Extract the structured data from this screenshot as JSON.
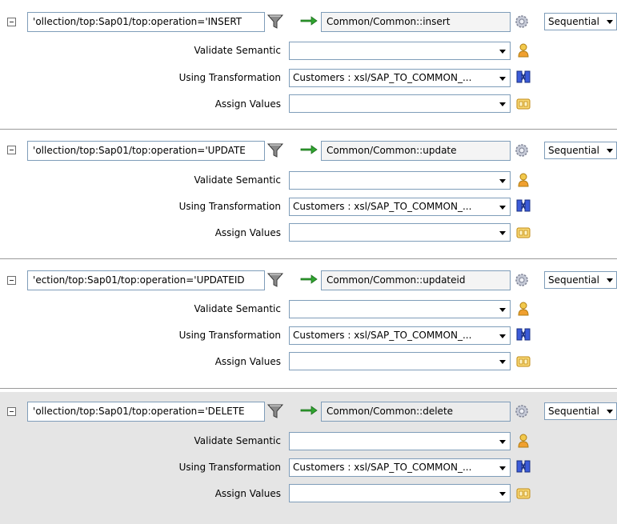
{
  "labels": {
    "validate_semantic": "Validate Semantic",
    "using_transformation": "Using Transformation",
    "assign_values": "Assign Values"
  },
  "routings": [
    {
      "filter_expression": "ollection/top:Sap01/top:operation='INSERT'",
      "target_operation": "Common/Common::insert",
      "execution": "Sequential",
      "validate_semantic": "",
      "transformation": "Customers : xsl/SAP_TO_COMMON_...",
      "assign_values": ""
    },
    {
      "filter_expression": "ollection/top:Sap01/top:operation='UPDATE'",
      "target_operation": "Common/Common::update",
      "execution": "Sequential",
      "validate_semantic": "",
      "transformation": "Customers : xsl/SAP_TO_COMMON_...",
      "assign_values": ""
    },
    {
      "filter_expression": "ection/top:Sap01/top:operation='UPDATEID'",
      "target_operation": "Common/Common::updateid",
      "execution": "Sequential",
      "validate_semantic": "",
      "transformation": "Customers : xsl/SAP_TO_COMMON_...",
      "assign_values": ""
    },
    {
      "filter_expression": "ollection/top:Sap01/top:operation='DELETE'",
      "target_operation": "Common/Common::delete",
      "execution": "Sequential",
      "validate_semantic": "",
      "transformation": "Customers : xsl/SAP_TO_COMMON_...",
      "assign_values": ""
    }
  ],
  "icons": {
    "collapse": "collapse-minus-icon",
    "filter": "filter-funnel-icon",
    "routes_to": "green-arrow-icon",
    "operation_browse": "gear-icon",
    "validate": "person-icon",
    "transform": "transformation-map-icon",
    "assign": "assign-values-icon"
  }
}
